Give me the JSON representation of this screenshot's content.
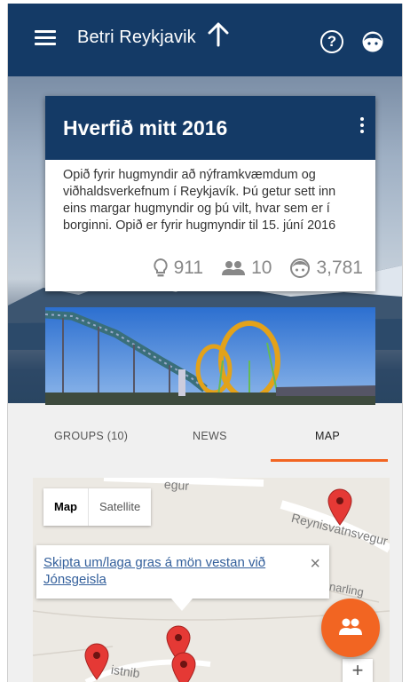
{
  "header": {
    "title": "Betri Reykjavik",
    "icons": [
      "menu-icon",
      "arrow-up-icon",
      "help-icon",
      "face-icon"
    ]
  },
  "card": {
    "title": "Hverfið mitt 2016",
    "description": "Opið fyrir hugmyndir að nýframkvæmdum og viðhaldsverkefnum í Reykjavík. Þú getur sett inn eins margar hugmyndir og þú vilt, hvar sem er í borginni.   Opið er fyrir hugmyndir til 15. júní 2016",
    "stats": {
      "ideas": "911",
      "groups": "10",
      "users": "3,781"
    }
  },
  "tabs": [
    {
      "label": "GROUPS  (10)"
    },
    {
      "label": "NEWS"
    },
    {
      "label": "MAP"
    }
  ],
  "map": {
    "type_map": "Map",
    "type_satellite": "Satellite",
    "info_link": "Skipta um/laga gras á mön vestan við Jónsgeisla",
    "close_label": "×",
    "zoom_in": "+",
    "road_labels": [
      "egur",
      "Reynisvatnsvegur",
      "narling",
      "istnib"
    ]
  },
  "colors": {
    "header_bg": "#143a66",
    "accent": "#f26522",
    "link": "#34609c",
    "pin": "#e53935"
  }
}
